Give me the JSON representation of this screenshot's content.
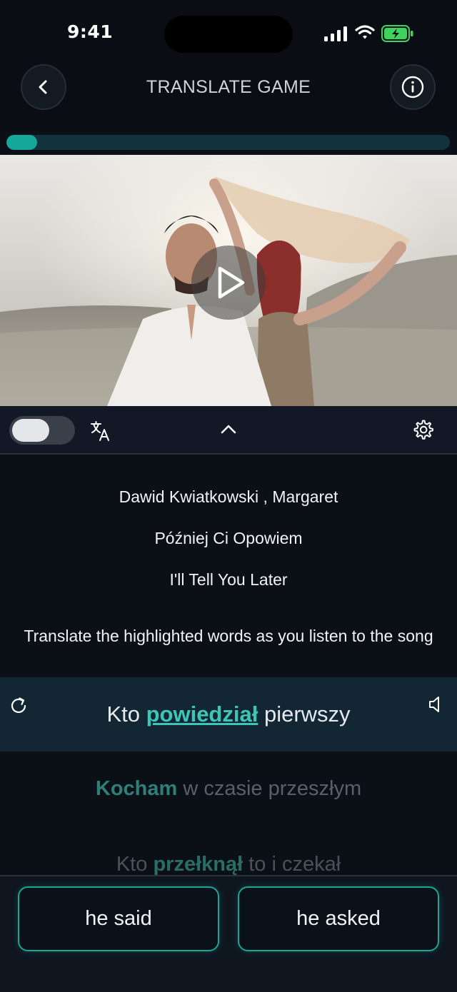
{
  "status_bar": {
    "time": "9:41"
  },
  "header": {
    "title": "TRANSLATE GAME"
  },
  "progress": {
    "fraction": 0.07
  },
  "song": {
    "artist": "Dawid Kwiatkowski , Margaret",
    "title_original": "Później Ci Opowiem",
    "title_translated": "I'll Tell You Later"
  },
  "instruction": "Translate the highlighted words as you listen to the song",
  "lyrics": {
    "active": {
      "before": "Kto ",
      "highlight": "powiedział",
      "after": " pierwszy"
    },
    "next1": {
      "before": "",
      "highlight": "Kocham",
      "after": " w czasie przeszłym"
    },
    "next2": {
      "before": "Kto ",
      "highlight": "przełknął",
      "after": " to i czekał"
    }
  },
  "answers": [
    "he said",
    "he asked"
  ],
  "icons": {
    "back": "chevron-left-icon",
    "info": "info-icon",
    "play": "play-icon",
    "translate": "translate-icon",
    "collapse": "chevron-up-icon",
    "settings": "gear-icon",
    "refresh": "refresh-icon",
    "audio": "speaker-icon"
  },
  "colors": {
    "accent": "#15a89a",
    "highlight": "#3fc5b8",
    "background": "#0b0f16"
  }
}
